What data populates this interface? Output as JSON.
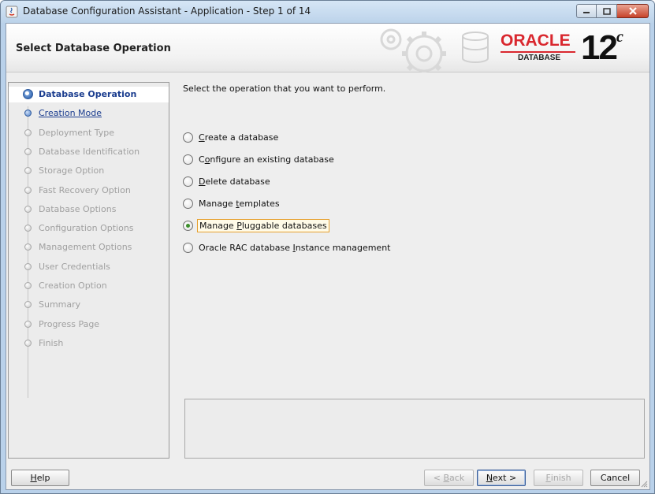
{
  "window": {
    "title": "Database Configuration Assistant - Application - Step 1 of 14",
    "controls": [
      "minimize",
      "maximize",
      "close"
    ]
  },
  "header": {
    "page_title": "Select Database Operation",
    "logo_text": "ORACLE",
    "logo_sub": "DATABASE",
    "version": "12",
    "version_sup": "c"
  },
  "steps": [
    {
      "label": "Database Operation",
      "state": "current"
    },
    {
      "label": "Creation Mode",
      "state": "link"
    },
    {
      "label": "Deployment Type",
      "state": "disabled"
    },
    {
      "label": "Database Identification",
      "state": "disabled"
    },
    {
      "label": "Storage Option",
      "state": "disabled"
    },
    {
      "label": "Fast Recovery Option",
      "state": "disabled"
    },
    {
      "label": "Database Options",
      "state": "disabled"
    },
    {
      "label": "Configuration Options",
      "state": "disabled"
    },
    {
      "label": "Management Options",
      "state": "disabled"
    },
    {
      "label": "User Credentials",
      "state": "disabled"
    },
    {
      "label": "Creation Option",
      "state": "disabled"
    },
    {
      "label": "Summary",
      "state": "disabled"
    },
    {
      "label": "Progress Page",
      "state": "disabled"
    },
    {
      "label": "Finish",
      "state": "disabled"
    }
  ],
  "main": {
    "instruction": "Select the operation that you want to perform.",
    "options": [
      {
        "pre": "",
        "u": "C",
        "post": "reate a database",
        "selected": false
      },
      {
        "pre": "C",
        "u": "o",
        "post": "nfigure an existing database",
        "selected": false
      },
      {
        "pre": "",
        "u": "D",
        "post": "elete database",
        "selected": false
      },
      {
        "pre": "Manage ",
        "u": "t",
        "post": "emplates",
        "selected": false
      },
      {
        "pre": "Manage ",
        "u": "P",
        "post": "luggable databases",
        "selected": true
      },
      {
        "pre": "Oracle RAC database ",
        "u": "I",
        "post": "nstance management",
        "selected": false
      }
    ]
  },
  "buttons": {
    "help": {
      "u": "H",
      "post": "elp"
    },
    "back": {
      "pre": "< ",
      "u": "B",
      "post": "ack"
    },
    "next": {
      "u": "N",
      "post": "ext >"
    },
    "finish": {
      "u": "F",
      "post": "inish"
    },
    "cancel": "Cancel"
  },
  "colors": {
    "link": "#1b3d8f",
    "oracle_red": "#d9272e",
    "focus_border": "#e6a030",
    "selected_radio": "#3c8f2c"
  }
}
